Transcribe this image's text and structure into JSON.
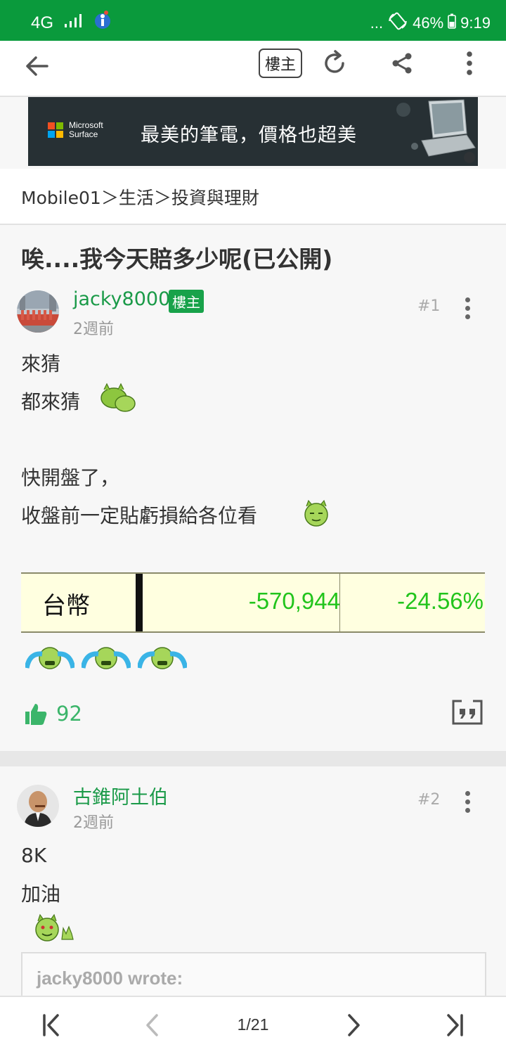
{
  "status_bar": {
    "network": "4G",
    "dots": "...",
    "battery": "46%",
    "time": "9:19"
  },
  "toolbar": {
    "owner_label": "樓主"
  },
  "ad": {
    "brand_line1": "Microsoft",
    "brand_line2": "Surface",
    "text": "最美的筆電，價格也超美"
  },
  "breadcrumb": "Mobile01＞生活＞投資與理財",
  "thread": {
    "title": "唉....我今天賠多少呢(已公開)"
  },
  "posts": [
    {
      "username": "jacky8000",
      "badge": "樓主",
      "time": "2週前",
      "number": "#1",
      "lines": [
        "來猜",
        "都來猜",
        "快開盤了，",
        "收盤前一定貼虧損給各位看"
      ],
      "table": {
        "currency": "台幣",
        "amount": "-570,944",
        "percent": "-24.56%"
      },
      "likes": "92"
    },
    {
      "username": "古錐阿土伯",
      "time": "2週前",
      "number": "#2",
      "lines": [
        "8K",
        "加油"
      ],
      "quote_author": "jacky8000 wrote:"
    }
  ],
  "pagination": {
    "page": "1/21"
  },
  "colors": {
    "brand_green": "#0a9a3c",
    "user_green": "#1a9a48",
    "positive_green": "#22c41c"
  }
}
